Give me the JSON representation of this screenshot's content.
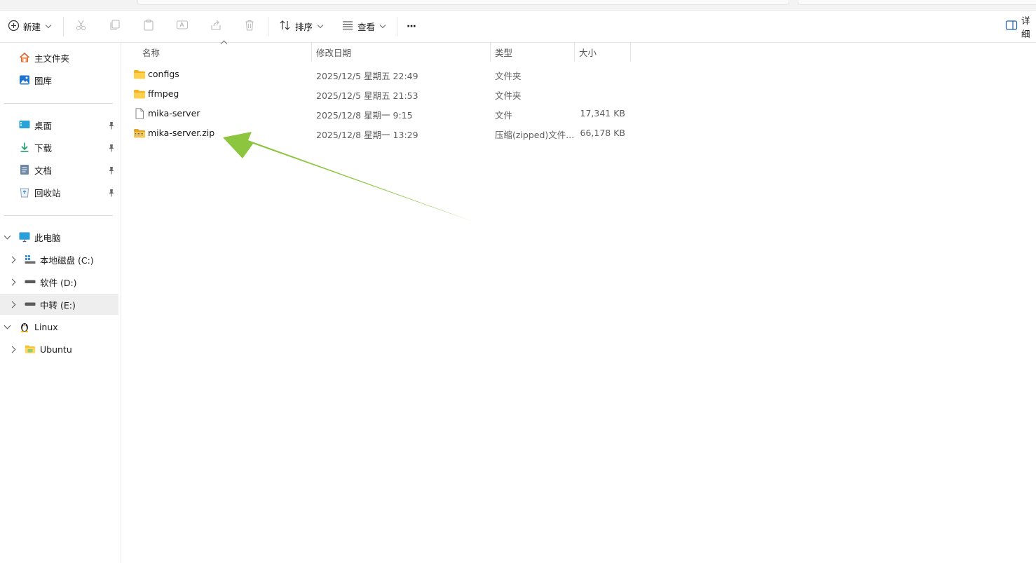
{
  "toolbar": {
    "new_label": "新建",
    "sort_label": "排序",
    "view_label": "查看",
    "more_label": "···",
    "details_label": "详细"
  },
  "nav": {
    "home": "主文件夹",
    "gallery": "图库",
    "quick": [
      {
        "label": "桌面"
      },
      {
        "label": "下载"
      },
      {
        "label": "文档"
      },
      {
        "label": "回收站"
      }
    ],
    "this_pc": "此电脑",
    "drives": [
      {
        "label": "本地磁盘 (C:)"
      },
      {
        "label": "软件 (D:)"
      },
      {
        "label": "中转 (E:)"
      }
    ],
    "linux": "Linux",
    "ubuntu": "Ubuntu"
  },
  "columns": {
    "name": "名称",
    "modified": "修改日期",
    "type": "类型",
    "size": "大小"
  },
  "files": [
    {
      "name": "configs",
      "modified": "2025/12/5 星期五 22:49",
      "type": "文件夹",
      "size": "",
      "icon": "folder-icon"
    },
    {
      "name": "ffmpeg",
      "modified": "2025/12/5 星期五 21:53",
      "type": "文件夹",
      "size": "",
      "icon": "folder-icon"
    },
    {
      "name": "mika-server",
      "modified": "2025/12/8 星期一 9:15",
      "type": "文件",
      "size": "17,341 KB",
      "icon": "file-icon"
    },
    {
      "name": "mika-server.zip",
      "modified": "2025/12/8 星期一 13:29",
      "type": "压缩(zipped)文件...",
      "size": "66,178 KB",
      "icon": "zip-folder-icon"
    }
  ],
  "colors": {
    "folder": "#f8c23a",
    "arrow": "#8cc63f",
    "selection": "#eeeeee",
    "accent": "#0067c0"
  }
}
